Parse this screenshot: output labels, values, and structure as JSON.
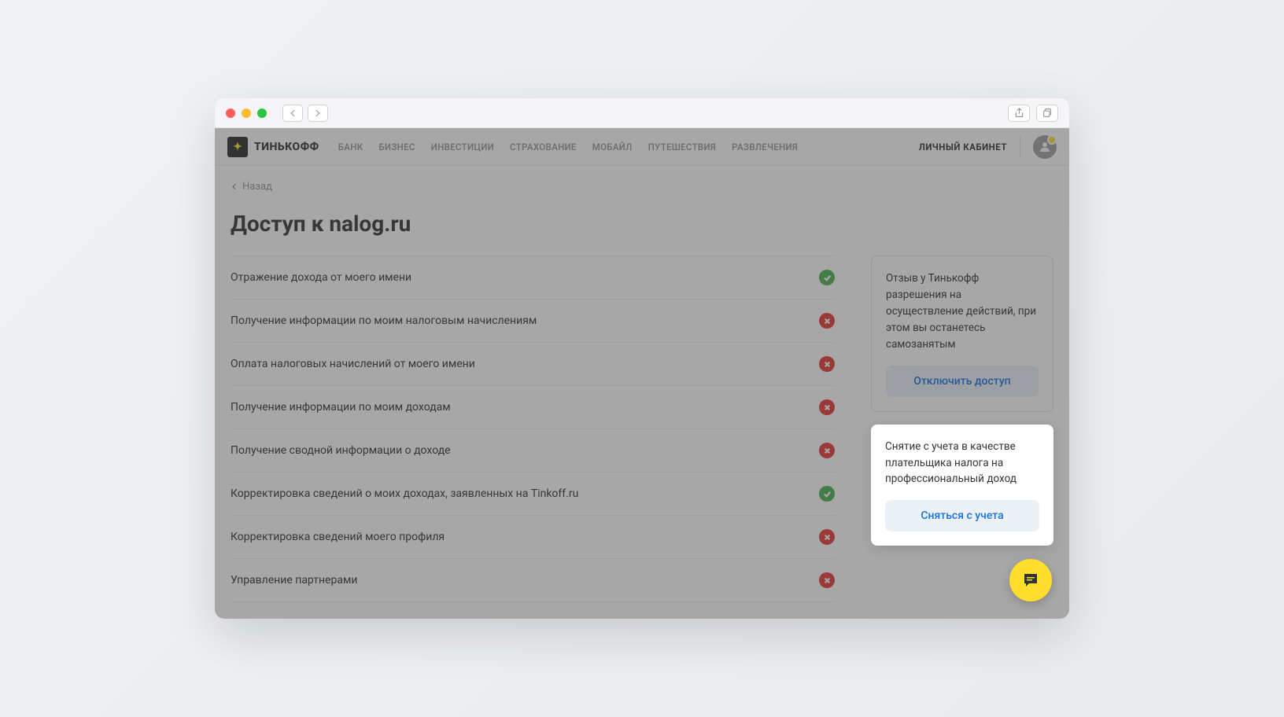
{
  "brand": "ТИНЬКОФФ",
  "nav": {
    "items": [
      "БАНК",
      "БИЗНЕС",
      "ИНВЕСТИЦИИ",
      "СТРАХОВАНИЕ",
      "МОБАЙЛ",
      "ПУТЕШЕСТВИЯ",
      "РАЗВЛЕЧЕНИЯ"
    ],
    "cabinet": "ЛИЧНЫЙ КАБИНЕТ"
  },
  "back_label": "Назад",
  "page_title": "Доступ к nalog.ru",
  "permissions": [
    {
      "label": "Отражение дохода от моего имени",
      "status": "ok"
    },
    {
      "label": "Получение информации по моим налоговым начислениям",
      "status": "no"
    },
    {
      "label": "Оплата налоговых начислений от моего имени",
      "status": "no"
    },
    {
      "label": "Получение информации по моим доходам",
      "status": "no"
    },
    {
      "label": "Получение сводной информации о доходе",
      "status": "no"
    },
    {
      "label": "Корректировка сведений о моих доходах, заявленных на Tinkoff.ru",
      "status": "ok"
    },
    {
      "label": "Корректировка сведений моего профиля",
      "status": "no"
    },
    {
      "label": "Управление партнерами",
      "status": "no"
    }
  ],
  "sidebar": {
    "card1": {
      "text": "Отзыв у Тинькофф разрешения на осуществление действий, при этом вы останетесь самозанятым",
      "button": "Отключить доступ"
    },
    "card2": {
      "text": "Снятие с учета в качестве плательщика налога на профессиональный доход",
      "button": "Сняться с учета"
    }
  }
}
